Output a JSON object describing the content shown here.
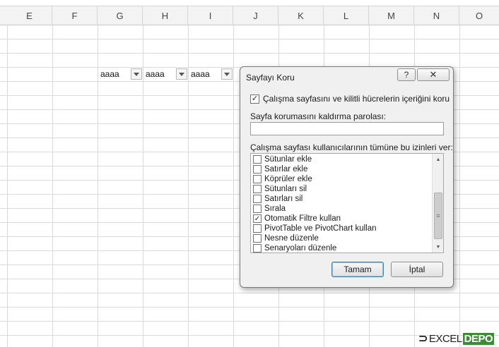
{
  "spreadsheet": {
    "columns": [
      "E",
      "F",
      "G",
      "H",
      "I",
      "J",
      "K",
      "L",
      "M",
      "N",
      "O"
    ],
    "filter_cells": [
      {
        "value": "aaaa"
      },
      {
        "value": "aaaa"
      },
      {
        "value": "aaaa"
      }
    ]
  },
  "dialog": {
    "title": "Sayfayı Koru",
    "help_label": "?",
    "close_label": "✕",
    "protect_label": "Çalışma sayfasını ve kilitli hücrelerin içeriğini koru",
    "protect_checked": true,
    "password_label": "Sayfa korumasını kaldırma parolası:",
    "password_value": "",
    "permissions_label": "Çalışma sayfası kullanıcılarının tümüne bu izinleri ver:",
    "permissions": [
      {
        "label": "Sütunlar ekle",
        "checked": false
      },
      {
        "label": "Satırlar ekle",
        "checked": false
      },
      {
        "label": "Köprüler ekle",
        "checked": false
      },
      {
        "label": "Sütunları sil",
        "checked": false
      },
      {
        "label": "Satırları sil",
        "checked": false
      },
      {
        "label": "Sırala",
        "checked": false
      },
      {
        "label": "Otomatik Filtre kullan",
        "checked": true
      },
      {
        "label": "PivotTable ve PivotChart kullan",
        "checked": false
      },
      {
        "label": "Nesne düzenle",
        "checked": false
      },
      {
        "label": "Senaryoları düzenle",
        "checked": false
      }
    ],
    "ok_label": "Tamam",
    "cancel_label": "İptal"
  },
  "watermark": {
    "excel_text": "EXCEL",
    "depo_text": "DEPO"
  },
  "colors": {
    "grid_line": "#dadada",
    "header_bg": "#f3f3f3",
    "dialog_bg": "#f0f0f0",
    "ok_border": "#3c7fb1",
    "watermark_green": "#3d8b37"
  }
}
